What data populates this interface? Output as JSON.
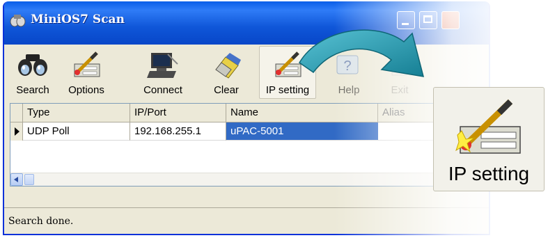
{
  "window": {
    "title": "MiniOS7 Scan"
  },
  "toolbar": {
    "buttons": [
      {
        "label": "Search",
        "icon": "binoculars-icon"
      },
      {
        "label": "Options",
        "icon": "options-icon"
      },
      {
        "label": "Connect",
        "icon": "computer-icon"
      },
      {
        "label": "Clear",
        "icon": "eraser-icon"
      },
      {
        "label": "IP setting",
        "icon": "ip-setting-icon"
      },
      {
        "label": "Help",
        "icon": "help-icon"
      },
      {
        "label": "Exit",
        "icon": "exit-icon"
      }
    ]
  },
  "grid": {
    "columns": [
      "Type",
      "IP/Port",
      "Name",
      "Alias"
    ],
    "rows": [
      {
        "type": "UDP Poll",
        "ip_port": "192.168.255.1",
        "name": "uPAC-5001",
        "alias": ""
      }
    ]
  },
  "status": {
    "text": "Search done."
  },
  "callout": {
    "label": "IP setting"
  },
  "colors": {
    "titlebar": "#0a5ee8",
    "selection": "#316ac5",
    "callout_arrow": "#1f8fa3",
    "face": "#ece9d8"
  }
}
